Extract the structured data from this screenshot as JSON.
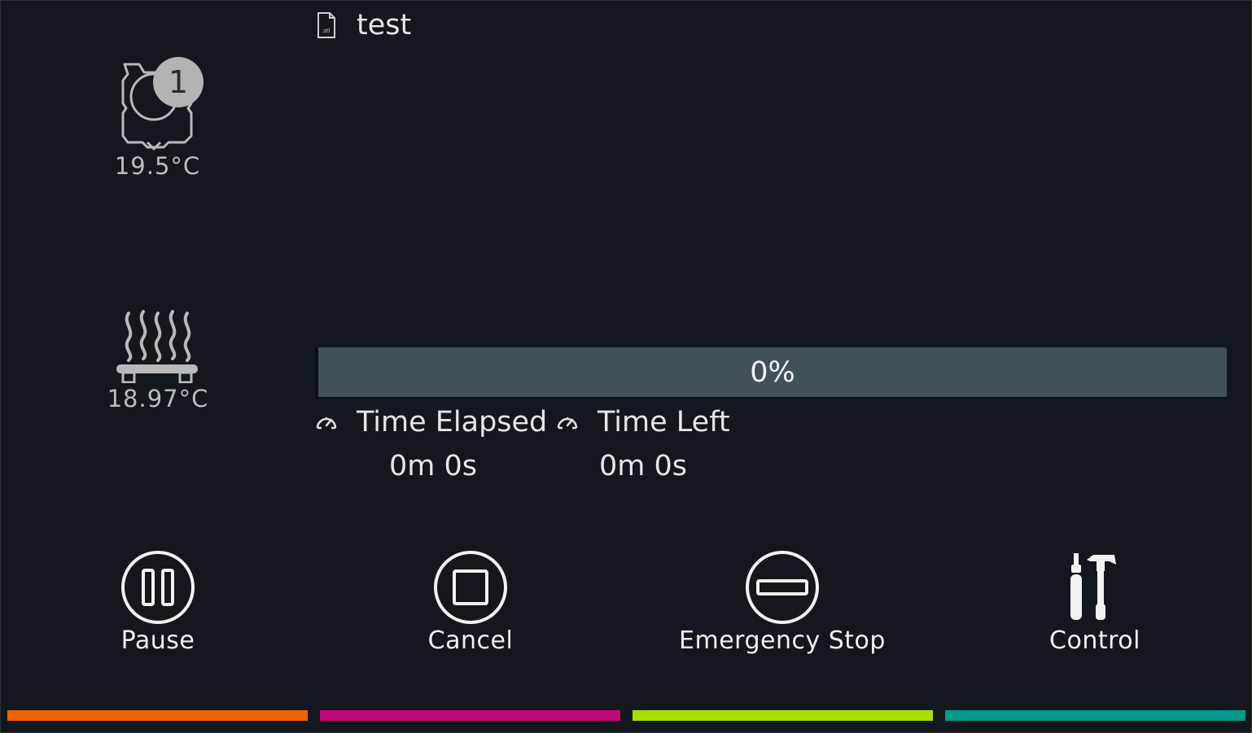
{
  "job": {
    "filename": "test",
    "file_icon": "stl-file-icon"
  },
  "extruder": {
    "icon": "extruder-icon",
    "badge": "1",
    "temperature": "19.5°C"
  },
  "bed": {
    "icon": "heated-bed-icon",
    "temperature": "18.97°C"
  },
  "progress": {
    "value": 0,
    "label": "0%"
  },
  "time": {
    "elapsed_label": "Time Elapsed",
    "elapsed_value": "0m 0s",
    "left_label": "Time Left",
    "left_value": "0m 0s",
    "icon": "speedometer-icon"
  },
  "actions": {
    "pause": {
      "label": "Pause",
      "icon": "pause-icon",
      "color": "#f06400"
    },
    "cancel": {
      "label": "Cancel",
      "icon": "stop-icon",
      "color": "#c0087a"
    },
    "emergency_stop": {
      "label": "Emergency Stop",
      "icon": "emergency-stop-icon",
      "color": "#a7e000"
    },
    "control": {
      "label": "Control",
      "icon": "control-tools-icon",
      "color": "#009b8a"
    }
  }
}
